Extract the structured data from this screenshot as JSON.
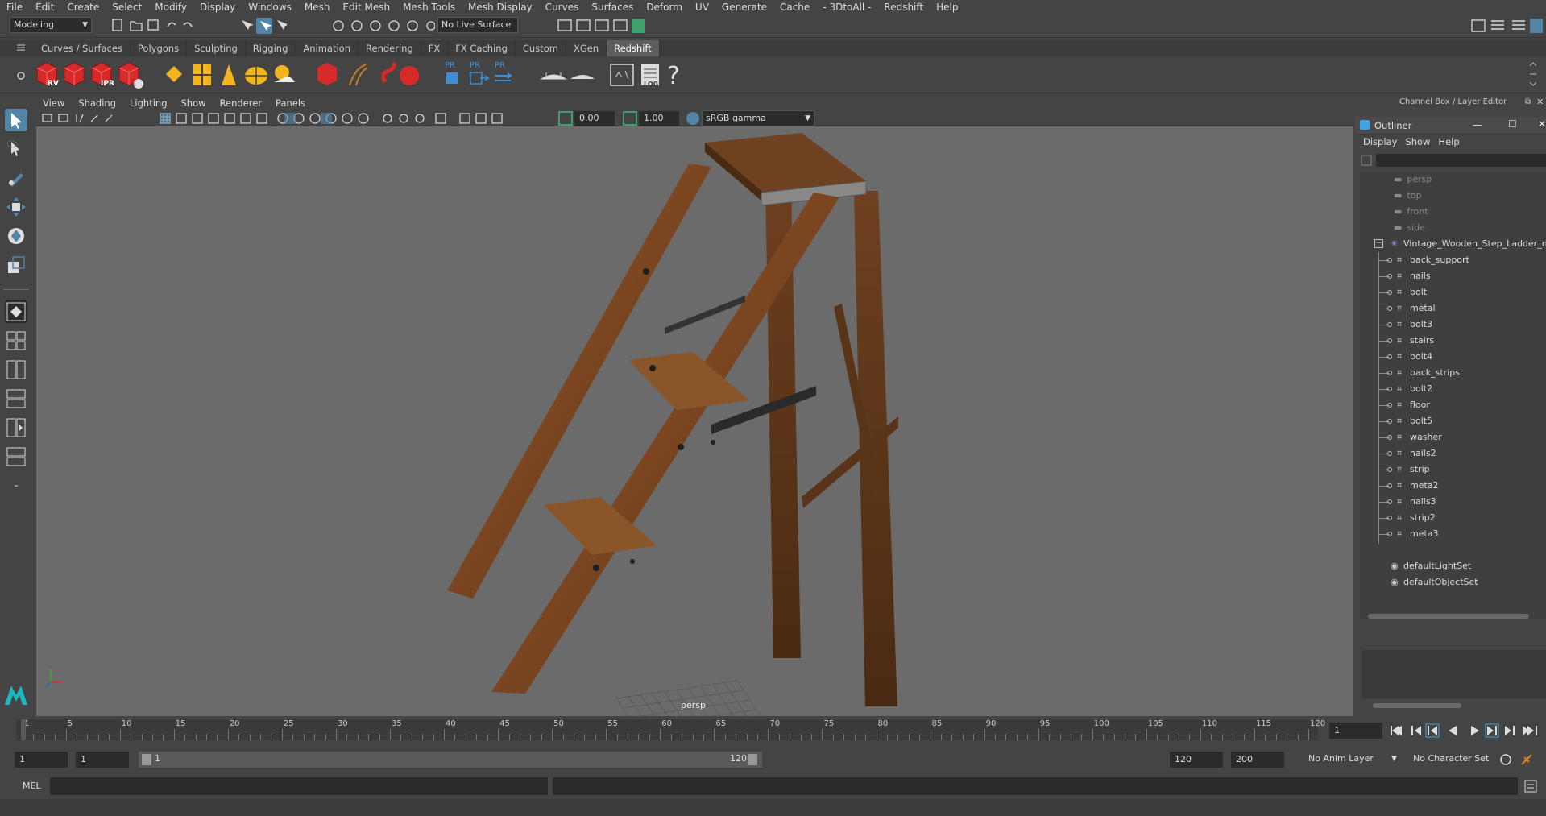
{
  "menubar": [
    "File",
    "Edit",
    "Create",
    "Select",
    "Modify",
    "Display",
    "Windows",
    "Mesh",
    "Edit Mesh",
    "Mesh Tools",
    "Mesh Display",
    "Curves",
    "Surfaces",
    "Deform",
    "UV",
    "Generate",
    "Cache",
    "- 3DtoAll -",
    "Redshift",
    "Help"
  ],
  "statusline": {
    "mode": "Modeling",
    "live_surface": "No Live Surface"
  },
  "shelf_tabs": [
    "Curves / Surfaces",
    "Polygons",
    "Sculpting",
    "Rigging",
    "Animation",
    "Rendering",
    "FX",
    "FX Caching",
    "Custom",
    "XGen",
    "Redshift"
  ],
  "active_shelf_tab": "Redshift",
  "shelf_labels": {
    "rv": "RV",
    "ipr": "IPR",
    "pr1": "PR",
    "pr2": "PR",
    "pr3": "PR",
    "log": "LOG"
  },
  "viewport": {
    "menu": [
      "View",
      "Shading",
      "Lighting",
      "Show",
      "Renderer",
      "Panels"
    ],
    "exposure": "0.00",
    "gamma": "1.00",
    "colorspace": "sRGB gamma",
    "camera_label": "persp"
  },
  "right_panel": {
    "header": "Channel Box / Layer Editor",
    "outliner_title": "Outliner",
    "outliner_menu": [
      "Display",
      "Show",
      "Help"
    ],
    "cameras": [
      "persp",
      "top",
      "front",
      "side"
    ],
    "group": "Vintage_Wooden_Step_Ladder_m",
    "children": [
      "back_support",
      "nails",
      "bolt",
      "metal",
      "bolt3",
      "stairs",
      "bolt4",
      "back_strips",
      "bolt2",
      "floor",
      "bolt5",
      "washer",
      "nails2",
      "strip",
      "meta2",
      "nails3",
      "strip2",
      "meta3"
    ],
    "sets": [
      "defaultLightSet",
      "defaultObjectSet"
    ]
  },
  "timeline": {
    "ticks": [
      "1",
      "5",
      "10",
      "15",
      "20",
      "25",
      "30",
      "35",
      "40",
      "45",
      "50",
      "55",
      "60",
      "65",
      "70",
      "75",
      "80",
      "85",
      "90",
      "95",
      "100",
      "105",
      "110",
      "115",
      "120"
    ],
    "current_frame": "1"
  },
  "range": {
    "start": "1",
    "inner_start": "1",
    "slider_start": "1",
    "slider_end": "120",
    "end": "120",
    "max": "200",
    "anim_layer": "No Anim Layer",
    "char_set": "No Character Set"
  },
  "cmdline": {
    "label": "MEL"
  },
  "colors": {
    "accent": "#5285a6",
    "redshift": "#d62a2a",
    "viewport_bg": "#6b6b6b"
  }
}
